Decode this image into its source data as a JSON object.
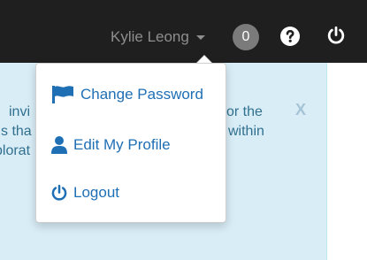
{
  "header": {
    "user_name": "Kylie Leong",
    "notification_count": "0",
    "icons": [
      "help-icon",
      "power-icon"
    ]
  },
  "alert": {
    "line1_left": "invi",
    "line1_right": "or the",
    "line2_left": "s tha",
    "line2_right": "within",
    "line3_left": "plorat",
    "close_label": "X"
  },
  "dropdown": {
    "items": [
      {
        "label": "Change Password",
        "icon": "flag-icon"
      },
      {
        "label": "Edit My Profile",
        "icon": "user-icon"
      },
      {
        "label": "Logout",
        "icon": "power-icon"
      }
    ]
  },
  "colors": {
    "topbar": "#1f1f1f",
    "alert_bg": "#d9edf7",
    "link": "#1f6fb5"
  }
}
